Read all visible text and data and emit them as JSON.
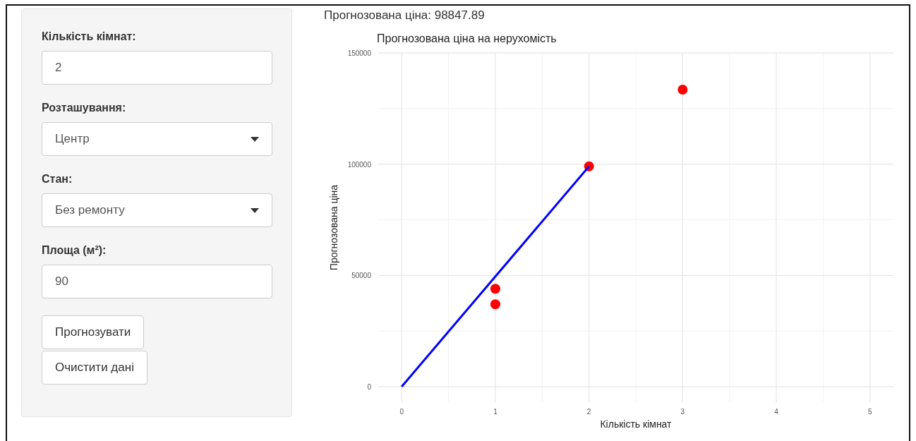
{
  "sidebar": {
    "fields": [
      {
        "kind": "input",
        "label": "Кількість кімнат:",
        "value": "2"
      },
      {
        "kind": "select",
        "label": "Розташування:",
        "value": "Центр"
      },
      {
        "kind": "select",
        "label": "Стан:",
        "value": "Без ремонту"
      },
      {
        "kind": "input",
        "label": "Площа (м²):",
        "value": "90"
      }
    ],
    "buttons": [
      "Прогнозувати",
      "Очистити дані"
    ]
  },
  "result": "Прогнозована ціна: 98847.89",
  "chart": {
    "chart_data": {
      "type": "scatter",
      "title": "Прогнозована ціна на нерухомість",
      "xlabel": "Кількість кімнат",
      "ylabel": "Прогнозована ціна",
      "xlim": [
        -0.25,
        5.25
      ],
      "ylim": [
        -7000,
        150000
      ],
      "xticks": [
        0,
        1,
        2,
        3,
        4,
        5
      ],
      "yticks": [
        0,
        50000,
        100000,
        150000
      ],
      "grid": true,
      "series": [
        {
          "color": "#ff0000",
          "x": [
            1,
            1,
            2,
            3
          ],
          "values": [
            44000,
            37000,
            99000,
            133500
          ]
        },
        {
          "type": "line",
          "color": "#0000ff",
          "x": [
            0,
            2
          ],
          "values": [
            0,
            99000
          ]
        }
      ]
    }
  }
}
